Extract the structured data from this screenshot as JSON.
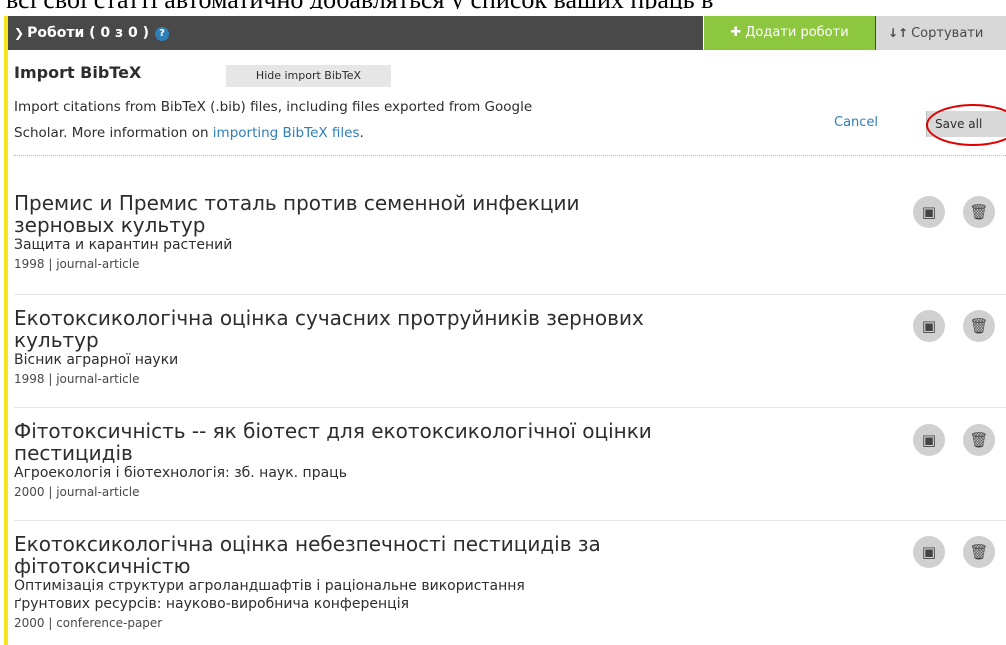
{
  "overhead_text": "всі свої статті автоматично добавляться у список ваших праць в",
  "header": {
    "chevron_icon": "chevron-down-icon",
    "title": "Роботи ( 0 з 0 )",
    "help_icon": "?",
    "add_label": "Додати роботи",
    "sort_label": "Сортувати",
    "colors": {
      "header_bg": "#494949",
      "add_bg": "#8dc63f",
      "sort_bg": "#d8d8d8",
      "left_bar": "#f5e61b"
    }
  },
  "import": {
    "title": "Import BibTeX",
    "hide_label": "Hide import BibTeX",
    "desc_line1": "Import citations from BibTeX (.bib) files, including files exported from Google",
    "desc_line2_prefix": "Scholar. More information on ",
    "desc_link": "importing BibTeX files",
    "desc_line2_suffix": ".",
    "cancel_label": "Cancel",
    "save_all_label": "Save all",
    "highlight_color": "#e00000"
  },
  "works": [
    {
      "title_line1": "Премис и Премис тоталь против семенной инфекции",
      "title_line2": "зерновых культур",
      "journal_line1": "Защита и карантин растений",
      "journal_line2": "",
      "meta": "1998 | journal-article"
    },
    {
      "title_line1": "Екотоксикологічна оцінка сучасних протруйників зернових",
      "title_line2": "культур",
      "journal_line1": "Вісник аграрної науки",
      "journal_line2": "",
      "meta": "1998 | journal-article"
    },
    {
      "title_line1": "Фітотоксичність -- як біотест для екотоксикологічної оцінки",
      "title_line2": "пестицидів",
      "journal_line1": "Агроекологія і біотехнологія: зб. наук. праць",
      "journal_line2": "",
      "meta": "2000 | journal-article"
    },
    {
      "title_line1": "Екотоксикологічна оцінка небезпечності пестицидів за",
      "title_line2": "фітотоксичністю",
      "journal_line1": "Оптимізація структури агроландшафтів і раціональне використання",
      "journal_line2": "ґрунтових ресурсів: науково-виробнича конференція",
      "meta": "2000 | conference-paper"
    }
  ],
  "icons": {
    "save": "save-icon",
    "delete": "trash-icon"
  }
}
